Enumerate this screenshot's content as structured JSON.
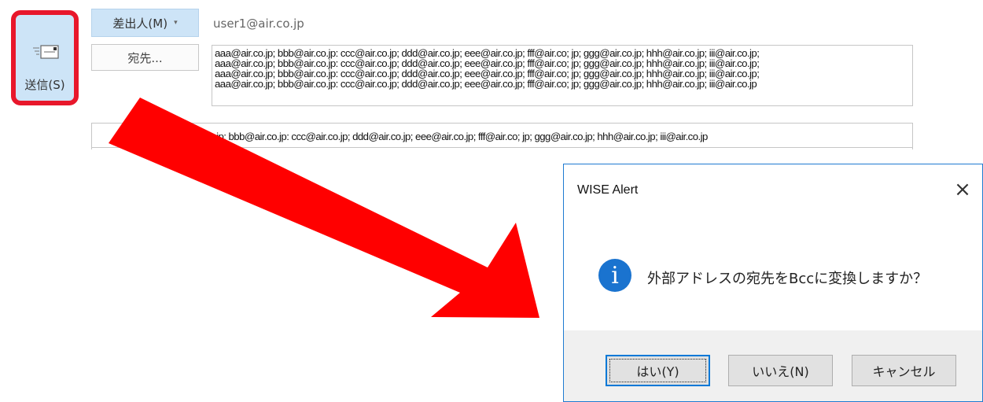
{
  "compose": {
    "send_label": "送信(S)",
    "send_icon": "send-envelope-icon",
    "from_label": "差出人(M)",
    "from_chevron": "▾",
    "from_value": "user1@air.co.jp",
    "to_label": "宛先...",
    "to_lines": [
      "aaa@air.co.jp; bbb@air.co.jp: ccc@air.co.jp; ddd@air.co.jp; eee@air.co.jp; fff@air.co; jp; ggg@air.co.jp; hhh@air.co.jp; iii@air.co.jp;",
      "aaa@air.co.jp; bbb@air.co.jp: ccc@air.co.jp; ddd@air.co.jp; eee@air.co.jp; fff@air.co; jp; ggg@air.co.jp; hhh@air.co.jp; iii@air.co.jp;",
      "aaa@air.co.jp; bbb@air.co.jp: ccc@air.co.jp; ddd@air.co.jp; eee@air.co.jp; fff@air.co; jp; ggg@air.co.jp; hhh@air.co.jp; iii@air.co.jp;",
      "aaa@air.co.jp; bbb@air.co.jp: ccc@air.co.jp; ddd@air.co.jp; eee@air.co.jp; fff@air.co; jp; ggg@air.co.jp; hhh@air.co.jp; iii@air.co.jp"
    ],
    "bcc_line": "aaa@air.co.jp; bbb@air.co.jp: ccc@air.co.jp; ddd@air.co.jp; eee@air.co.jp; fff@air.co; jp; ggg@air.co.jp; hhh@air.co.jp; iii@air.co.jp",
    "bcc_visible_prefix": ".jp; bbb@air.co.jp: ccc@air.co.jp; ddd@air.co.jp; eee@air.co.jp; fff@air.co; jp; ggg@air.co.jp; hhh@air.co.jp; iii@air.co.jp"
  },
  "dialog": {
    "title": "WISE Alert",
    "close": "×",
    "icon": "info-icon",
    "icon_glyph": "i",
    "message": "外部アドレスの宛先をBccに変換しますか？",
    "yes_label": "はい(Y)",
    "no_label": "いいえ(N)",
    "cancel_label": "キャンセル"
  },
  "colors": {
    "highlight_border": "#e8172b",
    "arrow": "#ff0000",
    "button_blue": "#cde4f7",
    "dialog_border": "#1f7bd1",
    "info_blue": "#1a73cf"
  }
}
